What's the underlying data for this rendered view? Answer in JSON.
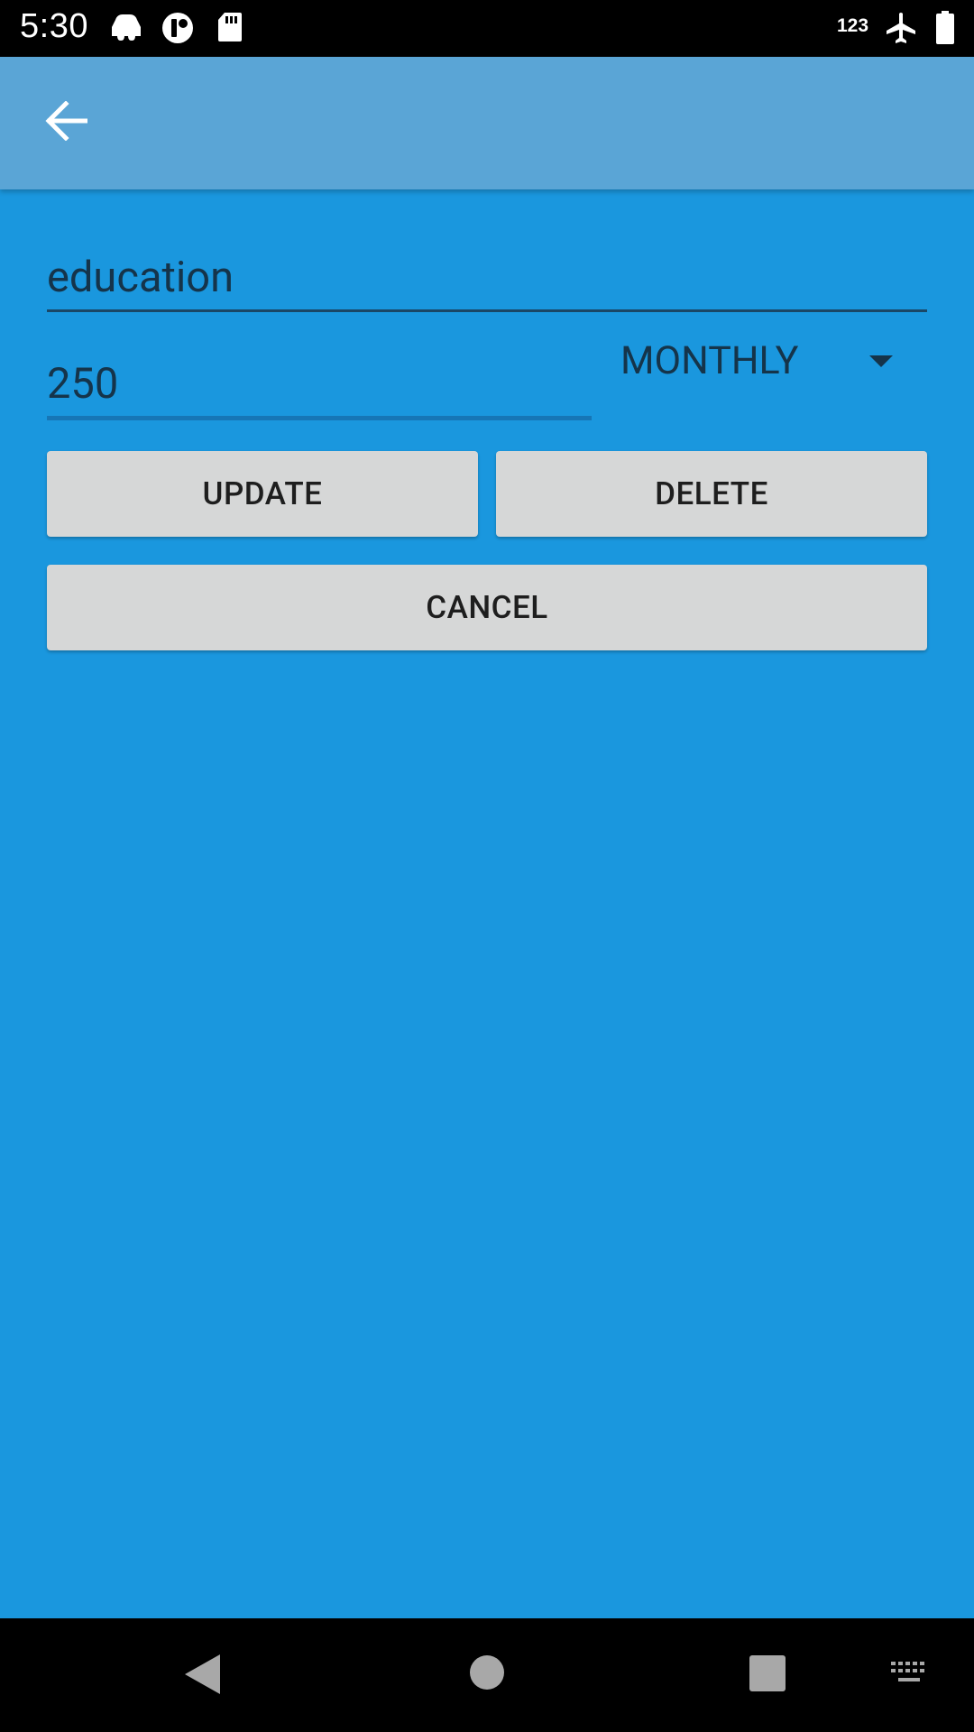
{
  "status_bar": {
    "time": "5:30",
    "indicator_text": "123",
    "icons": [
      "car-notification-icon",
      "app-notification-icon",
      "sd-card-icon",
      "airplane-mode-icon",
      "battery-icon"
    ]
  },
  "app_bar": {
    "back_icon": "arrow-back-icon"
  },
  "form": {
    "name_value": "education",
    "amount_value": "250",
    "frequency_selected": "MONTHLY",
    "dropdown_icon": "triangle-down-icon"
  },
  "actions": {
    "update_label": "UPDATE",
    "delete_label": "DELETE",
    "cancel_label": "CANCEL"
  },
  "nav_bar": {
    "icons": [
      "back-icon",
      "home-icon",
      "recents-icon",
      "keyboard-icon"
    ]
  },
  "colors": {
    "background": "#1a97de",
    "app_bar": "#5aa5d6",
    "button": "#d6d7d7",
    "input_underline": "#1676b6"
  }
}
